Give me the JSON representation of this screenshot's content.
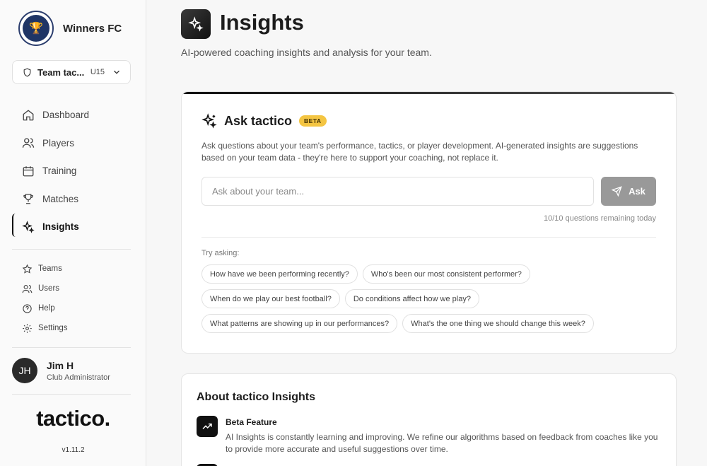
{
  "club": {
    "name": "Winners FC",
    "crest_icon": "trophy-crest-icon"
  },
  "team_selector": {
    "name": "Team tac...",
    "age_group": "U15"
  },
  "nav": {
    "items": [
      {
        "label": "Dashboard",
        "icon": "home-icon"
      },
      {
        "label": "Players",
        "icon": "users-icon"
      },
      {
        "label": "Training",
        "icon": "calendar-icon"
      },
      {
        "label": "Matches",
        "icon": "trophy-icon"
      },
      {
        "label": "Insights",
        "icon": "sparkles-icon",
        "active": true
      }
    ],
    "secondary": [
      {
        "label": "Teams",
        "icon": "star-icon"
      },
      {
        "label": "Users",
        "icon": "users-icon"
      },
      {
        "label": "Help",
        "icon": "help-circle-icon"
      },
      {
        "label": "Settings",
        "icon": "gear-icon"
      }
    ]
  },
  "user": {
    "initials": "JH",
    "name": "Jim H",
    "role": "Club Administrator"
  },
  "brand": {
    "name": "tactico.",
    "version": "v1.11.2"
  },
  "page": {
    "title": "Insights",
    "subtitle": "AI-powered coaching insights and analysis for your team."
  },
  "ask": {
    "title": "Ask tactico",
    "badge": "BETA",
    "description": "Ask questions about your team's performance, tactics, or player development. AI-generated insights are suggestions based on your team data - they're here to support your coaching, not replace it.",
    "input_placeholder": "Ask about your team...",
    "button_label": "Ask",
    "remaining": "10/10 questions remaining today",
    "try_label": "Try asking:",
    "suggestions": [
      "How have we been performing recently?",
      "Who's been our most consistent performer?",
      "When do we play our best football?",
      "Do conditions affect how we play?",
      "What patterns are showing up in our performances?",
      "What's the one thing we should change this week?"
    ]
  },
  "about": {
    "title": "About tactico Insights",
    "features": [
      {
        "title": "Beta Feature",
        "description": "AI Insights is constantly learning and improving. We refine our algorithms based on feedback from coaches like you to provide more accurate and useful suggestions over time."
      }
    ]
  },
  "colors": {
    "accent": "#111111",
    "beta_badge": "#f4c542",
    "ask_button": "#999999"
  }
}
